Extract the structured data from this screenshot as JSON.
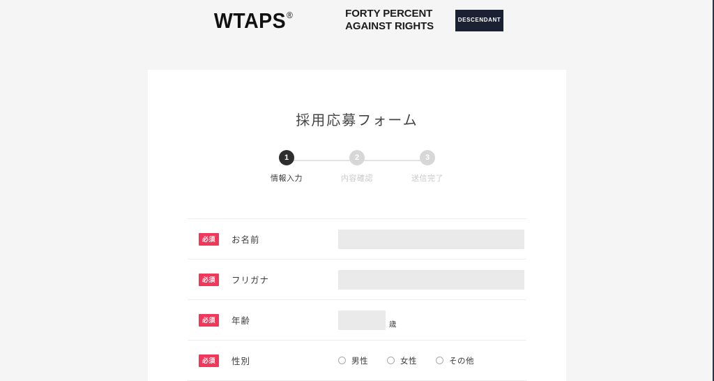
{
  "header": {
    "brands": {
      "wtaps": {
        "name": "WTAPS",
        "registered": "®"
      },
      "forty_percent": {
        "line1": "FORTY PERCENT",
        "line2": "AGAINST RIGHTS"
      },
      "descendant": {
        "label": "DESCENDANT"
      }
    }
  },
  "form": {
    "title": "採用応募フォーム",
    "stepper": {
      "current": 1,
      "steps": [
        {
          "number": "1",
          "label": "情報入力"
        },
        {
          "number": "2",
          "label": "内容確認"
        },
        {
          "number": "3",
          "label": "送信完了"
        }
      ]
    },
    "required_badge": "必須",
    "rows": [
      {
        "name": "name",
        "label": "お名前",
        "required": "必須",
        "type": "text",
        "value": "",
        "placeholder": ""
      },
      {
        "name": "furigana",
        "label": "フリガナ",
        "required": "必須",
        "type": "text",
        "value": "",
        "placeholder": ""
      },
      {
        "name": "age",
        "label": "年齢",
        "required": "必須",
        "type": "number",
        "value": "",
        "placeholder": "",
        "unit": "歳"
      },
      {
        "name": "gender",
        "label": "性別",
        "required": "必須",
        "type": "radio",
        "options": [
          {
            "label": "男性",
            "selected": false
          },
          {
            "label": "女性",
            "selected": false
          },
          {
            "label": "その他",
            "selected": false
          }
        ]
      }
    ]
  },
  "colors": {
    "page_background": "#f5f5f5",
    "card_background": "#ffffff",
    "required_badge": "#f2385a",
    "step_active": "#2e2e2e",
    "step_inactive": "#d7d7d7",
    "input_background": "#eaeaea",
    "descendant_badge": "#1b2133",
    "divider": "#ededed"
  }
}
